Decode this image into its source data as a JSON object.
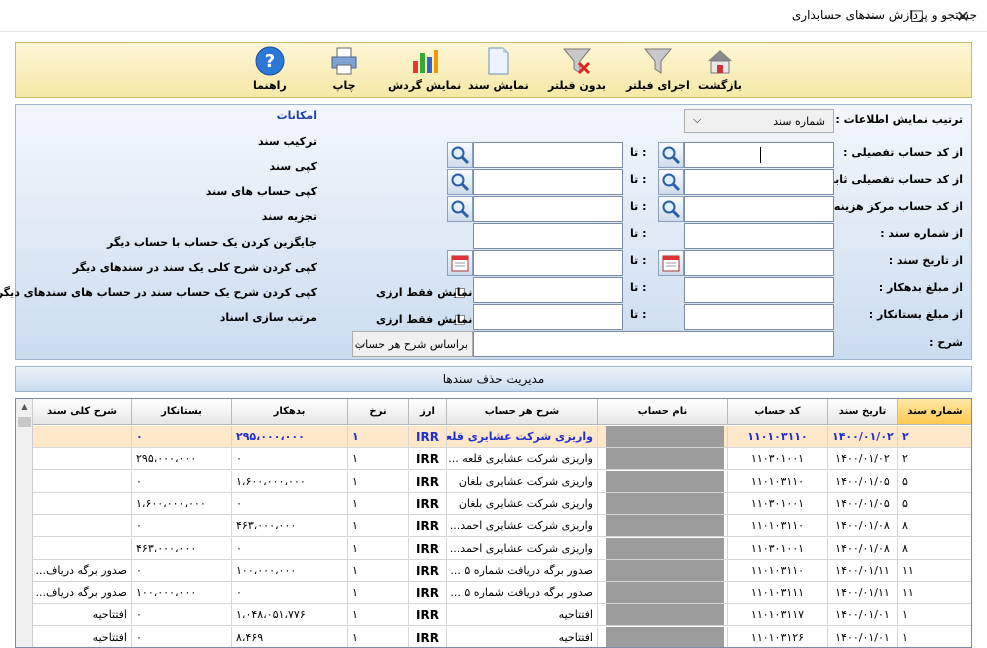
{
  "window": {
    "title": "جستجو و پردازش سندهای حسابداری"
  },
  "toolbar": {
    "back": "بازگشت",
    "apply_filter": "اجرای فیلتر",
    "no_filter": "بدون فیلتر",
    "show_voucher": "نمایش سند",
    "show_turnover": "نمایش گردش",
    "print": "چاپ",
    "help": "راهنما"
  },
  "filters": {
    "sort_label": "ترتیب نمایش اطلاعات :",
    "sort_value": "شماره سند",
    "from_detail_label": "از کد حساب تفصیلی :",
    "from_fixed_detail_label": "از کد حساب تفصیلی ثابت :",
    "from_cost_center_label": "از کد حساب مرکز هزینه :",
    "from_doc_no_label": "از شماره سند :",
    "from_doc_date_label": "از تاریخ سند :",
    "from_debit_label": "از مبلغ بدهکار :",
    "from_credit_label": "از مبلغ بستانکار :",
    "desc_label": "شرح :",
    "to_label": "تا :",
    "currency_only": "نمایش فقط ارزی",
    "desc_mode": "براساس شرح هر حساب"
  },
  "options": {
    "title": "امکانات",
    "items": [
      "ترکیب سند",
      "کپی سند",
      "کپی حساب های سند",
      "تجزیه سند",
      "جایگزین کردن یک حساب با حساب دیگر",
      "کپی کردن شرح کلی یک سند در سندهای دیگر",
      "کپی کردن شرح یک حساب سند در حساب های سندهای دیگر",
      "مرتب سازی اسناد"
    ]
  },
  "manage_bar": "مدیریت حذف سندها",
  "grid": {
    "headers": {
      "doc_no": "شماره سند",
      "doc_date": "تاریخ سند",
      "acc_code": "کد حساب",
      "acc_name": "نام حساب",
      "acc_desc": "شرح هر حساب",
      "currency": "ارز",
      "rate": "نرخ",
      "debit": "بدهکار",
      "credit": "بستانکار",
      "general_desc": "شرح کلی سند"
    },
    "rows": [
      {
        "doc_no": "۲",
        "doc_date": "۱۴۰۰/۰۱/۰۲",
        "acc_code": "۱۱۰۱۰۳۱۱۰",
        "acc_desc": "واریزی شرکت عشایری قلعه ...",
        "currency": "IRR",
        "rate": "۱",
        "debit": "۲۹۵،۰۰۰،۰۰۰",
        "credit": "۰",
        "general_desc": ""
      },
      {
        "doc_no": "۲",
        "doc_date": "۱۴۰۰/۰۱/۰۲",
        "acc_code": "۱۱۰۳۰۱۰۰۱",
        "acc_desc": "واریزی شرکت عشایری قلعه ...",
        "currency": "IRR",
        "rate": "۱",
        "debit": "۰",
        "credit": "۲۹۵،۰۰۰،۰۰۰",
        "general_desc": ""
      },
      {
        "doc_no": "۵",
        "doc_date": "۱۴۰۰/۰۱/۰۵",
        "acc_code": "۱۱۰۱۰۳۱۱۰",
        "acc_desc": "واریزی شرکت عشایری بلغان",
        "currency": "IRR",
        "rate": "۱",
        "debit": "۱،۶۰۰،۰۰۰،۰۰۰",
        "credit": "۰",
        "general_desc": ""
      },
      {
        "doc_no": "۵",
        "doc_date": "۱۴۰۰/۰۱/۰۵",
        "acc_code": "۱۱۰۳۰۱۰۰۱",
        "acc_desc": "واریزی شرکت عشایری بلغان",
        "currency": "IRR",
        "rate": "۱",
        "debit": "۰",
        "credit": "۱،۶۰۰،۰۰۰،۰۰۰",
        "general_desc": ""
      },
      {
        "doc_no": "۸",
        "doc_date": "۱۴۰۰/۰۱/۰۸",
        "acc_code": "۱۱۰۱۰۳۱۱۰",
        "acc_desc": "واریزی شرکت عشایری احمد...",
        "currency": "IRR",
        "rate": "۱",
        "debit": "۴۶۳،۰۰۰،۰۰۰",
        "credit": "۰",
        "general_desc": ""
      },
      {
        "doc_no": "۸",
        "doc_date": "۱۴۰۰/۰۱/۰۸",
        "acc_code": "۱۱۰۳۰۱۰۰۱",
        "acc_desc": "واریزی شرکت عشایری احمد...",
        "currency": "IRR",
        "rate": "۱",
        "debit": "۰",
        "credit": "۴۶۳،۰۰۰،۰۰۰",
        "general_desc": ""
      },
      {
        "doc_no": "۱۱",
        "doc_date": "۱۴۰۰/۰۱/۱۱",
        "acc_code": "۱۱۰۱۰۳۱۱۰",
        "acc_desc": "صدور برگه دریافت شماره ۵ ...",
        "currency": "IRR",
        "rate": "۱",
        "debit": "۱۰۰،۰۰۰،۰۰۰",
        "credit": "۰",
        "general_desc": "صدور برگه دریاف..."
      },
      {
        "doc_no": "۱۱",
        "doc_date": "۱۴۰۰/۰۱/۱۱",
        "acc_code": "۱۱۰۱۰۳۱۱۱",
        "acc_desc": "صدور برگه دریافت شماره ۵ ...",
        "currency": "IRR",
        "rate": "۱",
        "debit": "۰",
        "credit": "۱۰۰،۰۰۰،۰۰۰",
        "general_desc": "صدور برگه دریاف..."
      },
      {
        "doc_no": "۱",
        "doc_date": "۱۴۰۰/۰۱/۰۱",
        "acc_code": "۱۱۰۱۰۳۱۱۷",
        "acc_desc": "افتتاحیه",
        "currency": "IRR",
        "rate": "۱",
        "debit": "۱،۰۴۸،۰۵۱،۷۷۶",
        "credit": "۰",
        "general_desc": "افتتاحیه"
      },
      {
        "doc_no": "۱",
        "doc_date": "۱۴۰۰/۰۱/۰۱",
        "acc_code": "۱۱۰۱۰۳۱۲۶",
        "acc_desc": "افتتاحیه",
        "currency": "IRR",
        "rate": "۱",
        "debit": "۸،۴۶۹",
        "credit": "۰",
        "general_desc": "افتتاحیه"
      }
    ]
  },
  "colors": {
    "accent": "#1f2fd0",
    "toolbar_bg": "#f6e8a6",
    "panel_bg": "#cbdcef",
    "selected_row": "#ffe7c9"
  }
}
